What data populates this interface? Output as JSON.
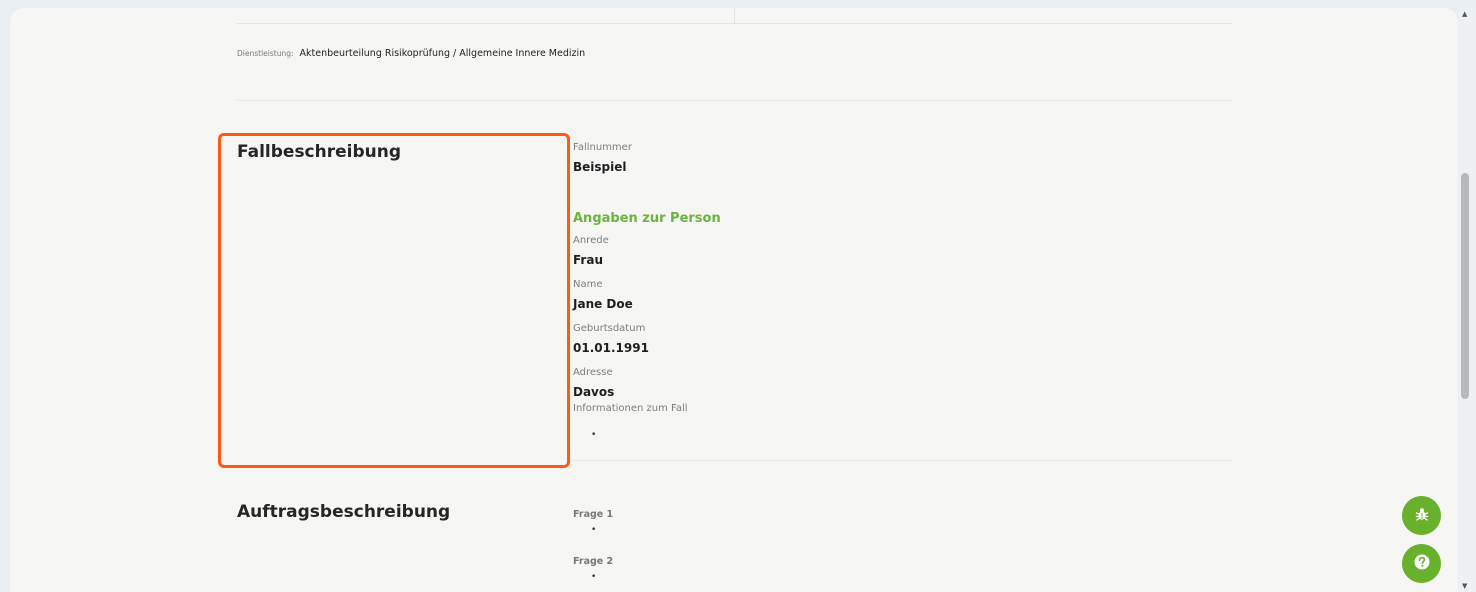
{
  "service": {
    "label": "Dienstleistung:",
    "value": "Aktenbeurteilung Risikoprüfung / Allgemeine Innere Medizin"
  },
  "fallbeschreibung": {
    "title": "Fallbeschreibung",
    "fallnummer_label": "Fallnummer",
    "fallnummer_value": "Beispiel",
    "person_heading": "Angaben zur Person",
    "anrede_label": "Anrede",
    "anrede_value": "Frau",
    "name_label": "Name",
    "name_value": "Jane Doe",
    "geburtsdatum_label": "Geburtsdatum",
    "geburtsdatum_value": "01.01.1991",
    "adresse_label": "Adresse",
    "adresse_value": "Davos",
    "info_label": "Informationen zum Fall",
    "info_bullet": "•"
  },
  "auftragsbeschreibung": {
    "title": "Auftragsbeschreibung",
    "questions": [
      {
        "label": "Frage 1",
        "bullet": "•"
      },
      {
        "label": "Frage 2",
        "bullet": "•"
      }
    ]
  },
  "colors": {
    "accent_green": "#6cb33f",
    "highlight_orange": "#ff5a0f",
    "fab_green": "#67b12d"
  },
  "icons": {
    "bug_report": "bug-icon",
    "help": "question-mark-icon"
  }
}
